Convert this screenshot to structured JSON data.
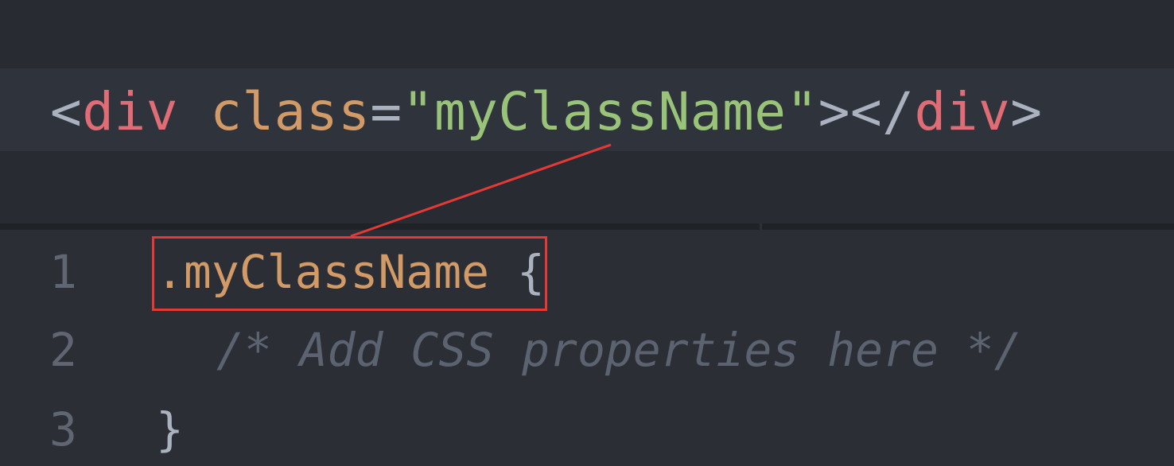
{
  "html_snippet": {
    "open_bracket": "<",
    "tag_open": "div",
    "space": " ",
    "attr_name": "class",
    "equals": "=",
    "quote_open": "\"",
    "attr_value": "myClassName",
    "quote_close": "\"",
    "close_open_tag": "></",
    "tag_close": "div",
    "end_bracket": ">"
  },
  "css_editor": {
    "lines": [
      {
        "number": "1",
        "selector": ".myClassName",
        "rest": " {"
      },
      {
        "number": "2",
        "comment": "/* Add CSS properties here */"
      },
      {
        "number": "3",
        "brace": "}"
      }
    ]
  },
  "colors": {
    "tag": "#e06c75",
    "attribute": "#d19a66",
    "string": "#98c379",
    "punctuation": "#abb2bf",
    "comment": "#5c6370",
    "highlight": "#e53935"
  }
}
